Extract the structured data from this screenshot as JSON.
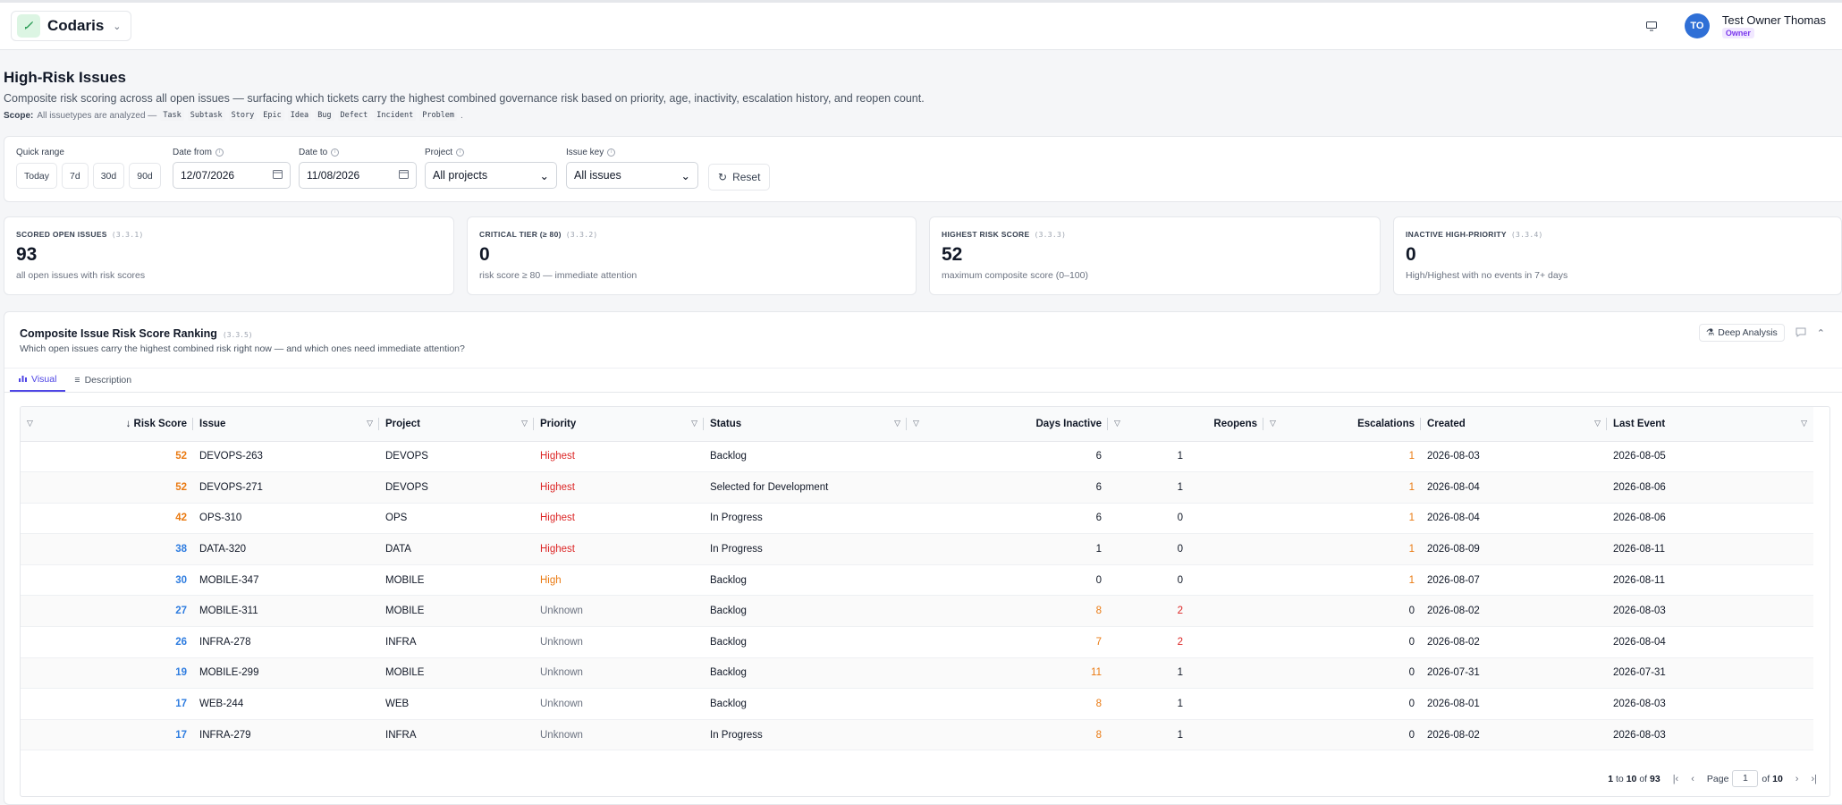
{
  "app": {
    "name": "Codaris"
  },
  "user": {
    "initials": "TO",
    "name": "Test Owner Thomas",
    "role": "Owner"
  },
  "page": {
    "title": "High-Risk Issues",
    "description": "Composite risk scoring across all open issues — surfacing which tickets carry the highest combined governance risk based on priority, age, inactivity, escalation history, and reopen count.",
    "scope_label": "Scope:",
    "scope_text": "All issuetypes are analyzed —",
    "issuetypes": [
      "Task",
      "Subtask",
      "Story",
      "Epic",
      "Idea",
      "Bug",
      "Defect",
      "Incident",
      "Problem"
    ]
  },
  "filters": {
    "quick_range_label": "Quick range",
    "quick_ranges": [
      "Today",
      "7d",
      "30d",
      "90d"
    ],
    "date_from_label": "Date from",
    "date_from": "12/07/2026",
    "date_to_label": "Date to",
    "date_to": "11/08/2026",
    "project_label": "Project",
    "project_value": "All projects",
    "issue_key_label": "Issue key",
    "issue_key_value": "All issues",
    "reset_label": "Reset"
  },
  "kpis": [
    {
      "label": "SCORED OPEN ISSUES",
      "code": "(3.3.1)",
      "value": "93",
      "sub": "all open issues with risk scores"
    },
    {
      "label": "CRITICAL TIER (≥ 80)",
      "code": "(3.3.2)",
      "value": "0",
      "sub": "risk score ≥ 80 — immediate attention"
    },
    {
      "label": "HIGHEST RISK SCORE",
      "code": "(3.3.3)",
      "value": "52",
      "sub": "maximum composite score (0–100)"
    },
    {
      "label": "INACTIVE HIGH-PRIORITY",
      "code": "(3.3.4)",
      "value": "0",
      "sub": "High/Highest with no events in 7+ days"
    }
  ],
  "panel": {
    "title": "Composite Issue Risk Score Ranking",
    "code": "(3.3.5)",
    "subtitle": "Which open issues carry the highest combined risk right now — and which ones need immediate attention?",
    "deep_analysis": "Deep Analysis",
    "tabs": [
      "Visual",
      "Description"
    ]
  },
  "table": {
    "columns": [
      "Risk Score",
      "Issue",
      "Project",
      "Priority",
      "Status",
      "Days Inactive",
      "Reopens",
      "Escalations",
      "Created",
      "Last Event"
    ],
    "rows": [
      [
        "52",
        "DEVOPS-263",
        "DEVOPS",
        "Highest",
        "Backlog",
        "6",
        "1",
        "1",
        "2026-08-03",
        "2026-08-05"
      ],
      [
        "52",
        "DEVOPS-271",
        "DEVOPS",
        "Highest",
        "Selected for Development",
        "6",
        "1",
        "1",
        "2026-08-04",
        "2026-08-06"
      ],
      [
        "42",
        "OPS-310",
        "OPS",
        "Highest",
        "In Progress",
        "6",
        "0",
        "1",
        "2026-08-04",
        "2026-08-06"
      ],
      [
        "38",
        "DATA-320",
        "DATA",
        "Highest",
        "In Progress",
        "1",
        "0",
        "1",
        "2026-08-09",
        "2026-08-11"
      ],
      [
        "30",
        "MOBILE-347",
        "MOBILE",
        "High",
        "Backlog",
        "0",
        "0",
        "1",
        "2026-08-07",
        "2026-08-11"
      ],
      [
        "27",
        "MOBILE-311",
        "MOBILE",
        "Unknown",
        "Backlog",
        "8",
        "2",
        "0",
        "2026-08-02",
        "2026-08-03"
      ],
      [
        "26",
        "INFRA-278",
        "INFRA",
        "Unknown",
        "Backlog",
        "7",
        "2",
        "0",
        "2026-08-02",
        "2026-08-04"
      ],
      [
        "19",
        "MOBILE-299",
        "MOBILE",
        "Unknown",
        "Backlog",
        "11",
        "1",
        "0",
        "2026-07-31",
        "2026-07-31"
      ],
      [
        "17",
        "WEB-244",
        "WEB",
        "Unknown",
        "Backlog",
        "8",
        "1",
        "0",
        "2026-08-01",
        "2026-08-03"
      ],
      [
        "17",
        "INFRA-279",
        "INFRA",
        "Unknown",
        "In Progress",
        "8",
        "1",
        "0",
        "2026-08-02",
        "2026-08-03"
      ]
    ]
  },
  "pagination": {
    "from": "1",
    "to_word": "to",
    "to": "10",
    "of_word": "of",
    "total": "93",
    "page_label": "Page",
    "page": "1",
    "page_of": "of",
    "pages": "10"
  },
  "colors": {
    "accent": "#4f46e5",
    "score_high": "#ea7a12",
    "score_low": "#2f7de0",
    "priority_highest": "#dc2626"
  }
}
